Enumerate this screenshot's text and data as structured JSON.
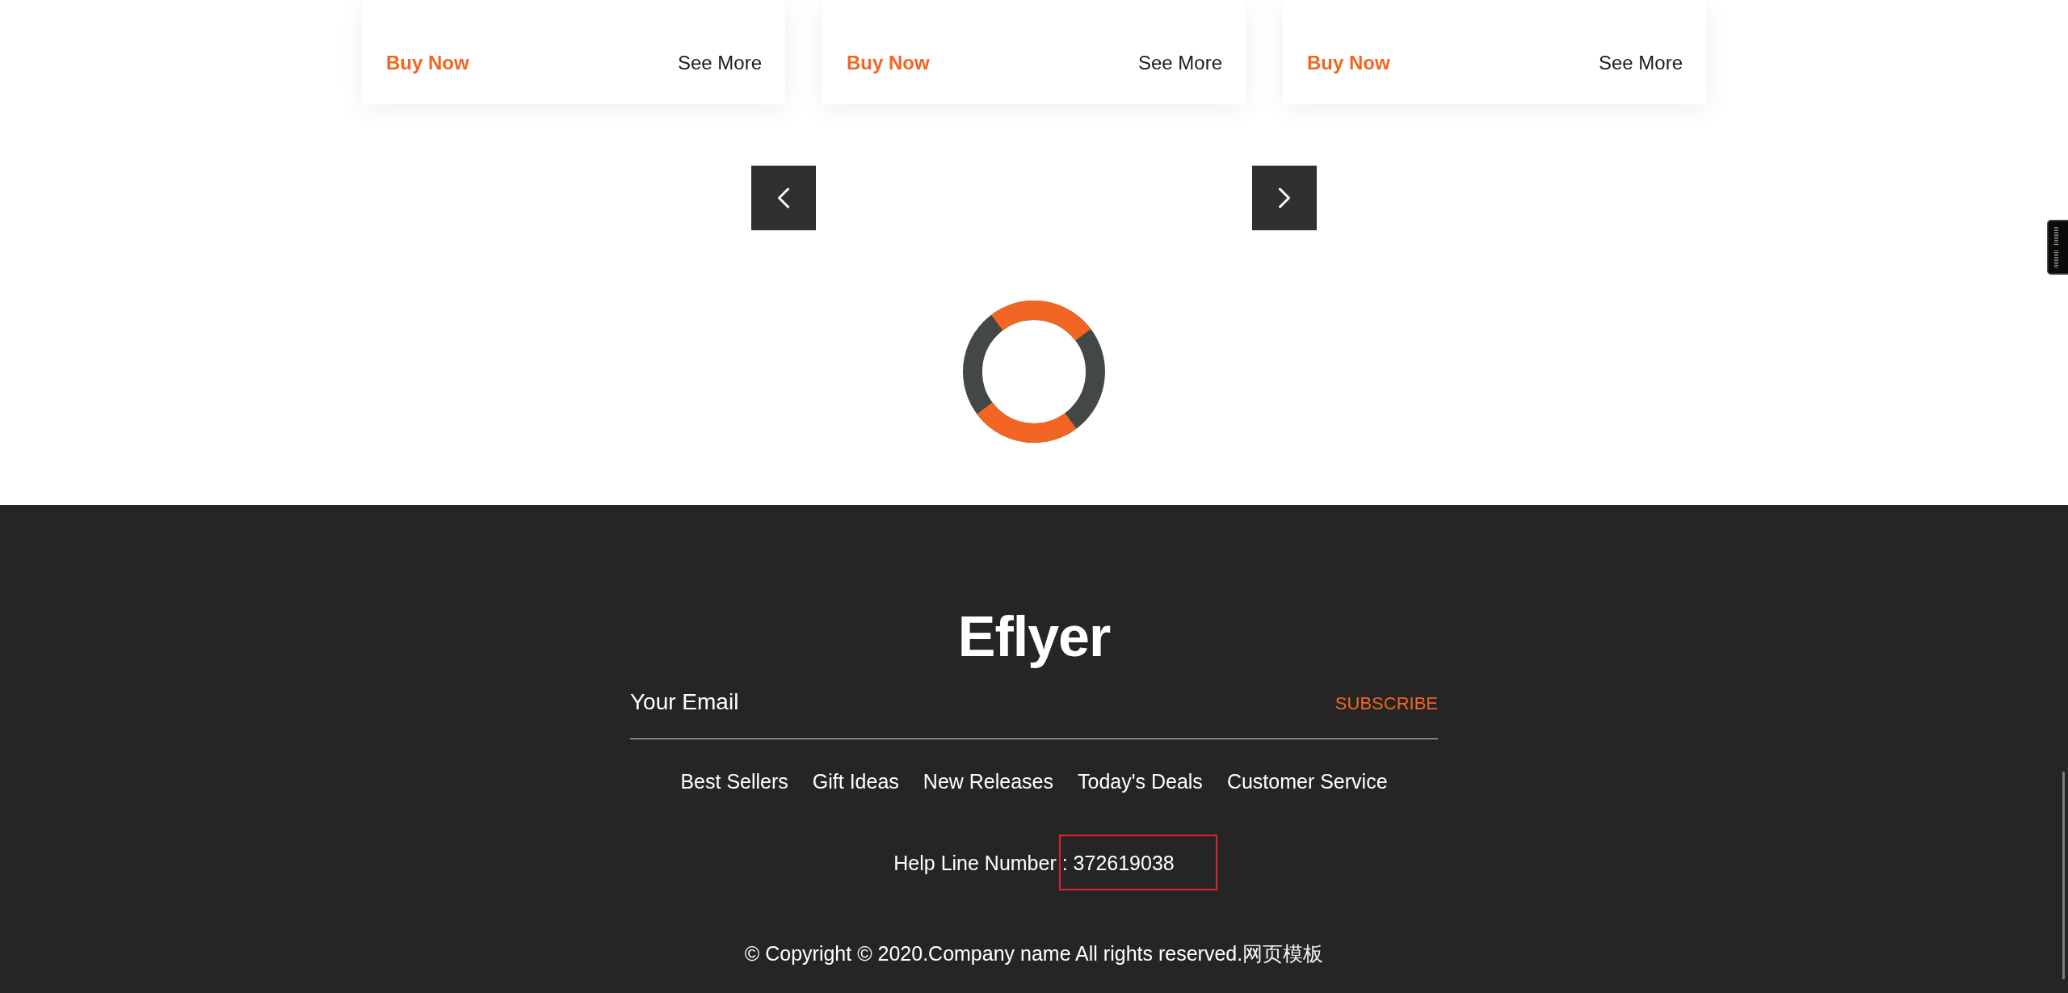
{
  "product_cards": [
    {
      "buy_label": "Buy Now",
      "more_label": "See More"
    },
    {
      "buy_label": "Buy Now",
      "more_label": "See More"
    },
    {
      "buy_label": "Buy Now",
      "more_label": "See More"
    }
  ],
  "footer": {
    "logo": "Eflyer",
    "email": {
      "placeholder": "Your Email"
    },
    "subscribe_button": "SUBSCRIBE",
    "nav_links": [
      "Best Sellers",
      "Gift Ideas",
      "New Releases",
      "Today's Deals",
      "Customer Service"
    ],
    "help_line": "Help Line Number : 372619038",
    "copyright": {
      "text": "© Copyright © 2020.Company name All rights reserved.",
      "link": "网页模板"
    }
  }
}
